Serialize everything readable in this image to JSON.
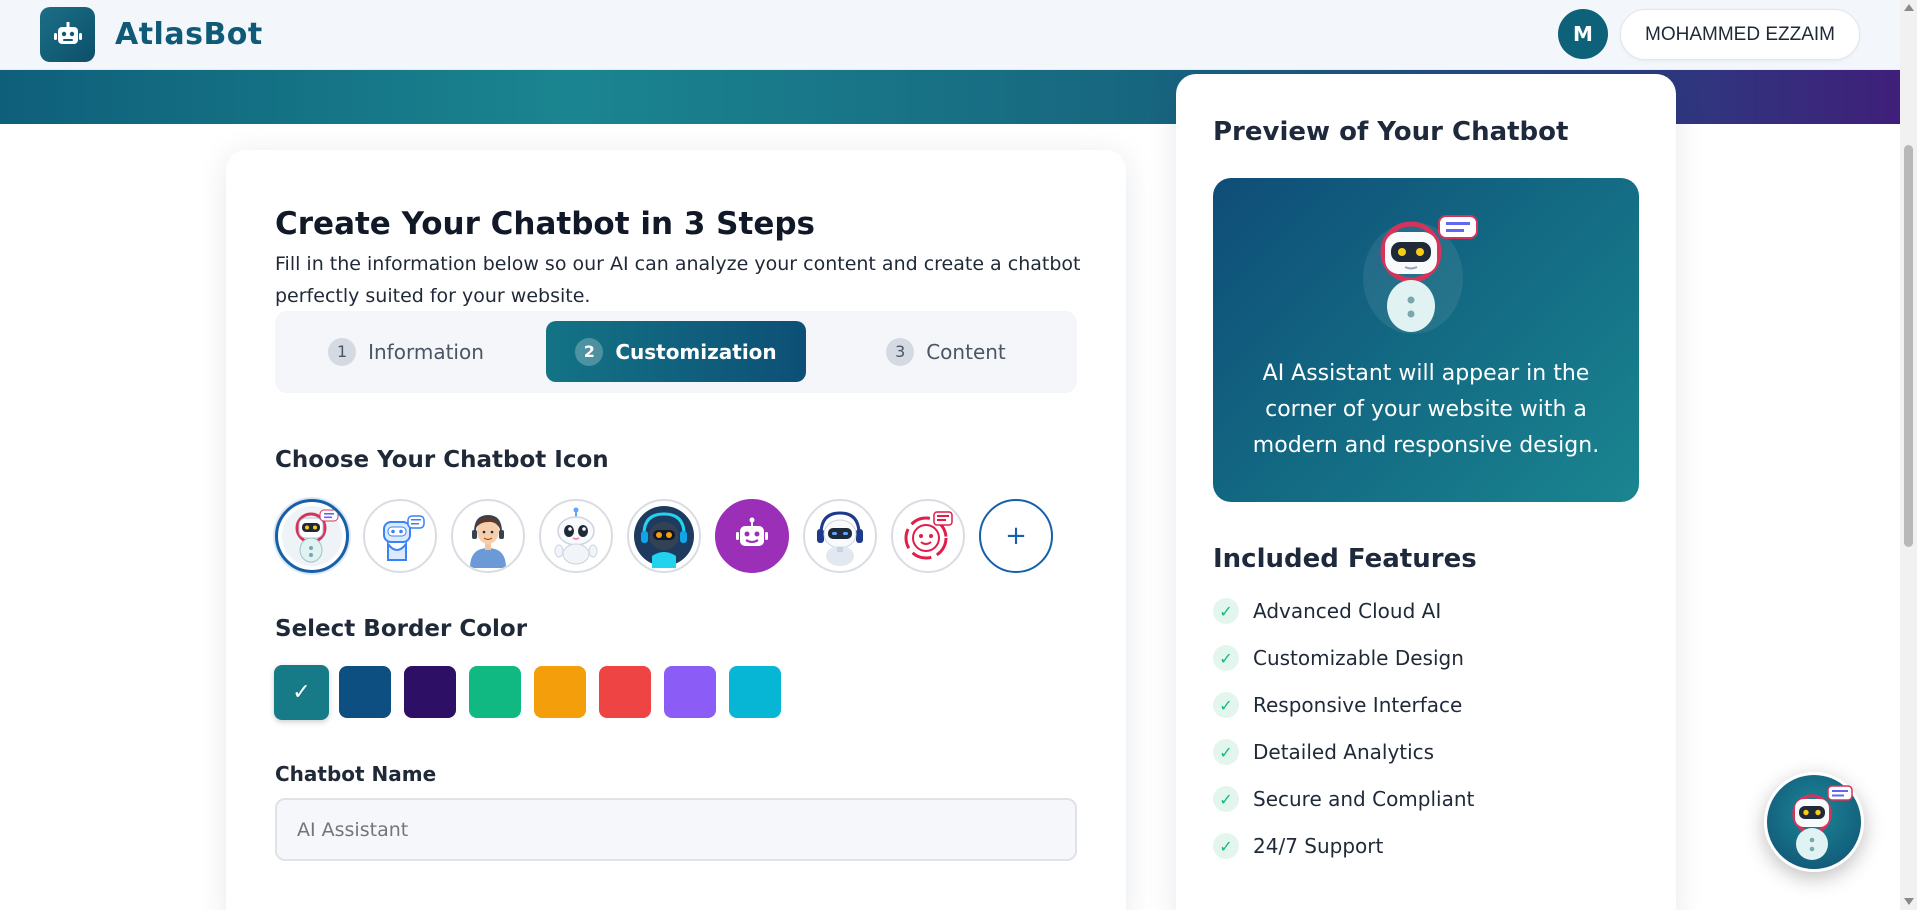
{
  "header": {
    "brand": "AtlasBot",
    "logo_icon": "robot-icon",
    "user_initial": "M",
    "user_name": "MOHAMMED EZZAIM"
  },
  "wizard": {
    "title": "Create Your Chatbot in 3 Steps",
    "subtitle": "Fill in the information below so our AI can analyze your content and create a chatbot perfectly suited for your website.",
    "steps": [
      {
        "num": "1",
        "label": "Information",
        "active": false
      },
      {
        "num": "2",
        "label": "Customization",
        "active": true
      },
      {
        "num": "3",
        "label": "Content",
        "active": false
      }
    ],
    "icon_section_label": "Choose Your Chatbot Icon",
    "icons": [
      {
        "name": "headset-robot-avatar",
        "selected": true
      },
      {
        "name": "outline-robot-avatar",
        "selected": false
      },
      {
        "name": "human-agent-avatar",
        "selected": false
      },
      {
        "name": "cute-robot-avatar",
        "selected": false
      },
      {
        "name": "dark-robot-avatar",
        "selected": false
      },
      {
        "name": "purple-robot-avatar",
        "selected": false
      },
      {
        "name": "headphone-robot-avatar",
        "selected": false
      },
      {
        "name": "red-support-avatar",
        "selected": false
      }
    ],
    "add_icon_label": "+",
    "color_section_label": "Select Border Color",
    "colors": [
      "#177b87",
      "#0c4f80",
      "#2e0f66",
      "#10b981",
      "#f59e0b",
      "#ef4444",
      "#8b5cf6",
      "#06b6d4"
    ],
    "selected_color_index": 0,
    "selected_mark": "✓",
    "name_label": "Chatbot Name",
    "name_placeholder": "AI Assistant"
  },
  "preview": {
    "title": "Preview of Your Chatbot",
    "description": "AI Assistant will appear in the corner of your website with a modern and responsive design.",
    "features_title": "Included Features",
    "check_mark": "✓",
    "features": [
      "Advanced Cloud AI",
      "Customizable Design",
      "Responsive Interface",
      "Detailed Analytics",
      "Secure and Compliant",
      "24/7 Support"
    ]
  }
}
